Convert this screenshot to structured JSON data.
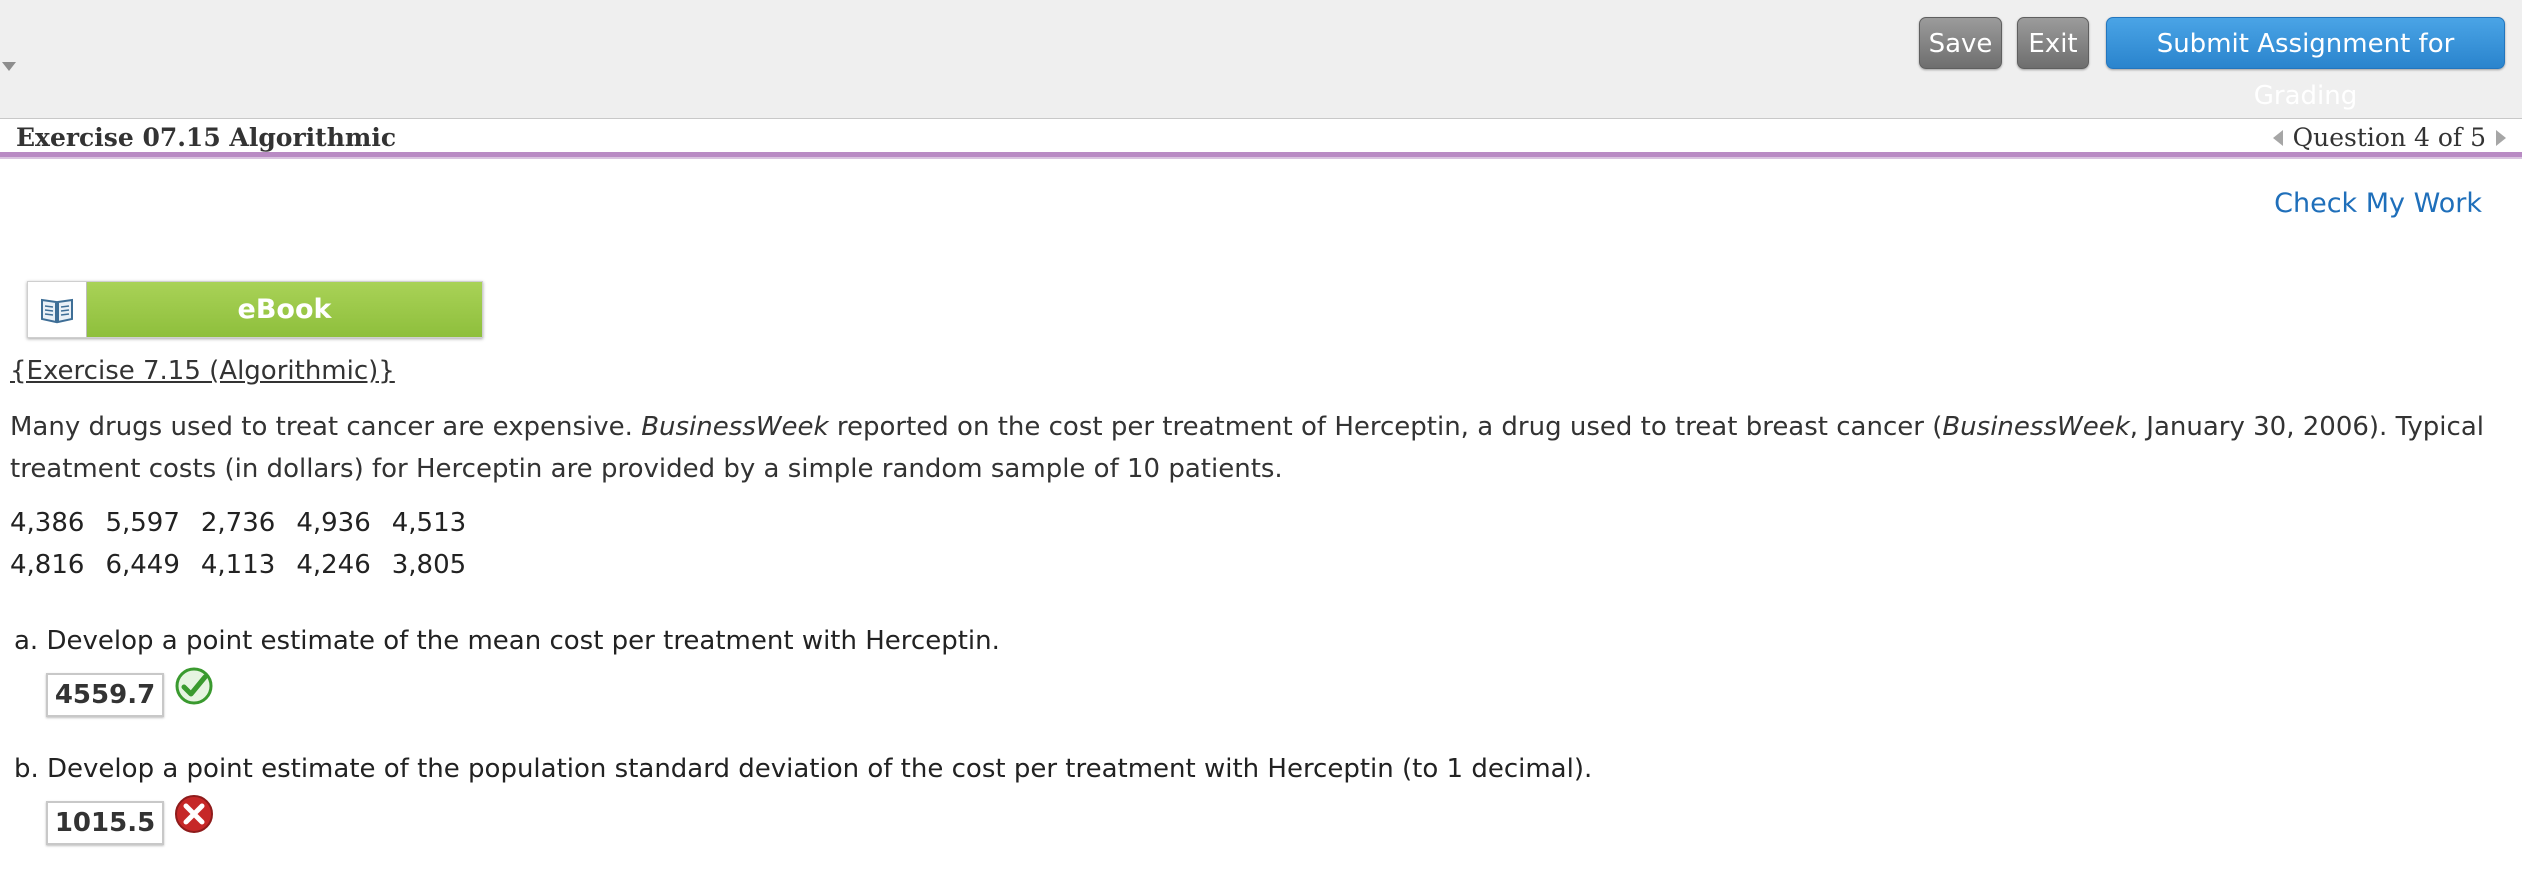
{
  "toolbar": {
    "save_label": "Save",
    "exit_label": "Exit",
    "submit_label": "Submit Assignment for Grading"
  },
  "exercise": {
    "title": "Exercise 07.15 Algorithmic",
    "question_nav": "Question 4 of 5"
  },
  "check_my_work": "Check My Work",
  "ebook": {
    "label": "eBook",
    "icon": "open-book-icon"
  },
  "problem": {
    "link_text": "{Exercise 7.15 (Algorithmic)}",
    "text_part1": "Many drugs used to treat cancer are expensive. ",
    "text_italic1": "BusinessWeek",
    "text_part2": " reported on the cost per treatment of Herceptin, a drug used to treat breast cancer (",
    "text_italic2": "BusinessWeek",
    "text_part3": ", January 30, 2006). Typical treatment costs (in dollars) for Herceptin are provided by a simple random sample of 10 patients.",
    "data_rows": [
      [
        "4,386",
        "5,597",
        "2,736",
        "4,936",
        "4,513"
      ],
      [
        "4,816",
        "6,449",
        "4,113",
        "4,246",
        "3,805"
      ]
    ]
  },
  "questions": [
    {
      "label": "a. Develop a point estimate of the mean cost per treatment with Herceptin.",
      "answer": "4559.7",
      "status": "correct"
    },
    {
      "label": "b. Develop a point estimate of the population standard deviation of the cost per treatment with Herceptin (to 1 decimal).",
      "answer": "1015.5",
      "status": "incorrect"
    }
  ],
  "colors": {
    "accent_blue": "#2a84cd",
    "ebook_green": "#8ebf3c",
    "divider_purple": "#b98bc4",
    "correct_green": "#3a9a2f",
    "incorrect_red": "#c62828"
  }
}
